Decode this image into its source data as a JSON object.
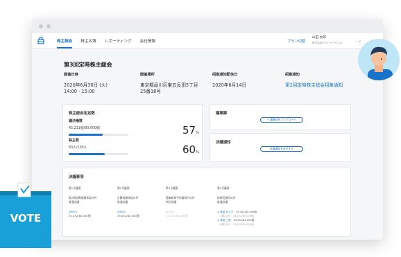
{
  "nav": {
    "items": [
      {
        "label": "株主総会",
        "active": true
      },
      {
        "label": "株主名簿",
        "active": false
      },
      {
        "label": "レポーティング",
        "active": false
      },
      {
        "label": "会社情報",
        "active": false
      }
    ],
    "plan_link": "プラン切替",
    "user_name": "山田 太郎",
    "company": "株式会社デリバリーモンキ"
  },
  "page_title": "第3回定時株主総会",
  "info": {
    "date_label": "開催日時",
    "date_value": "2020年6月30日 (火)",
    "time_value": "14:00 - 15:00",
    "place_label": "開催場所",
    "place_value": "東京都品川区東五反田5丁目",
    "place_value2": "25番18号",
    "notice_date_label": "招集通知配信日",
    "notice_date_value": "2020年6月14日",
    "notice_label": "招集通知",
    "notice_link": "第2回定時株主総会招集通知"
  },
  "quorum": {
    "title": "株主総会定足数",
    "rows": [
      {
        "label": "議決権数",
        "sub": "45,231個/80,000個",
        "percent": 57,
        "pct_label": "57",
        "unit": "%"
      },
      {
        "label": "株主数",
        "sub": "60人/100人",
        "percent": 60,
        "pct_label": "60",
        "unit": "%"
      }
    ]
  },
  "minutes": {
    "title": "議事録",
    "button": "+ 議事録をアップロード"
  },
  "resolution_notice": {
    "title": "決議通知",
    "button": "決議通知を送付する"
  },
  "resolutions": {
    "title": "決議事項",
    "items": [
      {
        "num": "第1号議案",
        "name": "第2期計算書類承認の件",
        "name2": "普通決議",
        "pct": "◎65%",
        "votes": "33,452/80,000個",
        "faded": false
      },
      {
        "num": "第2号議案",
        "name": "計算書類承認の件",
        "name2": "普通決議",
        "pct": "◎65%",
        "votes": "33,452/80,000個",
        "faded": false
      },
      {
        "num": "第3号議案",
        "name": "募集新株予約権発行の件",
        "name2": "特別決議",
        "pct": "◎39%",
        "votes": "33,452/80,000個",
        "faded": true
      }
    ],
    "fourth": {
      "num": "第4号議案",
      "name": "取締役選任の件",
      "name2": "普通決議",
      "candidates": [
        {
          "name": "◎ 承認 ゆうき",
          "votes": "33,452/80,000個",
          "active": true
        },
        {
          "name": "　大橋 なか",
          "votes": "33,452/80,000個",
          "active": false
        },
        {
          "name": "◎ 承認 二郎",
          "votes": "33,452/80,000個",
          "active": true
        },
        {
          "name": "　大橋 なか",
          "votes": "33,452/80,000個",
          "active": false
        }
      ]
    }
  },
  "vote_label": "VOTE",
  "colors": {
    "accent": "#1a73c9",
    "vote_blue": "#1aa0d8"
  }
}
